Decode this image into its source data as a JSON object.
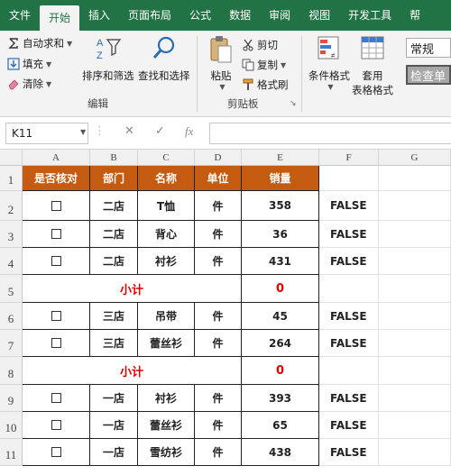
{
  "ribbon_tabs": [
    "文件",
    "开始",
    "插入",
    "页面布局",
    "公式",
    "数据",
    "审阅",
    "视图",
    "开发工具",
    "帮"
  ],
  "active_tab": "开始",
  "editing": {
    "autosum": "自动求和",
    "fill": "填充",
    "clear": "清除",
    "sort_filter": "排序和筛选",
    "find_select": "查找和选择",
    "group": "编辑"
  },
  "clipboard": {
    "paste": "粘贴",
    "cut": "剪切",
    "copy": "复制",
    "format_painter": "格式刷",
    "group": "剪贴板"
  },
  "styles": {
    "conditional_format": "条件格式",
    "table_format_1": "套用",
    "table_format_2": "表格格式",
    "style_normal": "常规",
    "style_check": "检查单"
  },
  "formula_bar": {
    "name_box": "K11",
    "cancel": "✕",
    "enter": "✓",
    "fx": "fx",
    "formula": ""
  },
  "columns": [
    "A",
    "B",
    "C",
    "D",
    "E",
    "F",
    "G"
  ],
  "rows": [
    "1",
    "2",
    "3",
    "4",
    "5",
    "6",
    "7",
    "8",
    "9",
    "10",
    "11"
  ],
  "table": {
    "headers": [
      "是否核对",
      "部门",
      "名称",
      "单位",
      "销量"
    ],
    "data_rows": [
      {
        "dept": "二店",
        "name": "T恤",
        "unit": "件",
        "qty": "358",
        "f": "FALSE"
      },
      {
        "dept": "二店",
        "name": "背心",
        "unit": "件",
        "qty": "36",
        "f": "FALSE"
      },
      {
        "dept": "二店",
        "name": "衬衫",
        "unit": "件",
        "qty": "431",
        "f": "FALSE"
      },
      {
        "subtotal_label": "小计",
        "subtotal_value": "0"
      },
      {
        "dept": "三店",
        "name": "吊带",
        "unit": "件",
        "qty": "45",
        "f": "FALSE"
      },
      {
        "dept": "三店",
        "name": "蕾丝衫",
        "unit": "件",
        "qty": "264",
        "f": "FALSE"
      },
      {
        "subtotal_label": "小计",
        "subtotal_value": "0"
      },
      {
        "dept": "一店",
        "name": "衬衫",
        "unit": "件",
        "qty": "393",
        "f": "FALSE"
      },
      {
        "dept": "一店",
        "name": "蕾丝衫",
        "unit": "件",
        "qty": "65",
        "f": "FALSE"
      },
      {
        "dept": "一店",
        "name": "雪纺衫",
        "unit": "件",
        "qty": "438",
        "f": "FALSE"
      }
    ]
  },
  "colors": {
    "ribbon_green": "#217346",
    "header_fill": "#c55a11",
    "subtotal_red": "#e00000"
  }
}
